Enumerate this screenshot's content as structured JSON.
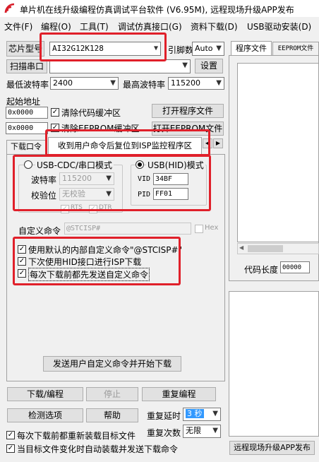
{
  "window": {
    "title": "单片机在线升级编程仿真调试平台软件 (V6.95M), 远程现场升级APP发布"
  },
  "menu": [
    "文件(F)",
    "编程(O)",
    "工具(T)",
    "调试仿真接口(G)",
    "资料下载(D)",
    "USB驱动安装(D)"
  ],
  "left": {
    "chip_label": "芯片型号",
    "chip_value": "AI32G12K128",
    "pin_label": "引脚数",
    "pin_value": "Auto",
    "scan_port": "扫描串口",
    "settings": "设置",
    "min_baud_label": "最低波特率",
    "min_baud_value": "2400",
    "max_baud_label": "最高波特率",
    "max_baud_value": "115200",
    "start_addr_label": "起始地址",
    "addr1": "0x0000",
    "clear_code": "清除代码缓冲区",
    "open_program": "打开程序文件",
    "addr2": "0x0000",
    "clear_eeprom": "清除EEPROM缓冲区",
    "open_eeprom": "打开EEPROM文件"
  },
  "subtabs": {
    "download_port": "下载口令",
    "isp_reset": "收到用户命令后复位到ISP监控程序区"
  },
  "isp": {
    "usb_cdc_label": "USB-CDC/串口模式",
    "baud_label": "波特率",
    "baud_value": "115200",
    "parity_label": "校验位",
    "parity_value": "无校验",
    "rts_label": "RTS",
    "dtr_label": "DTR",
    "usb_hid_label": "USB(HID)模式",
    "vid_label": "VID",
    "vid_value": "34BF",
    "pid_label": "PID",
    "pid_value": "FF01",
    "custom_cmd_label": "自定义命令",
    "custom_cmd_value": "@STCISP#",
    "hex_label": "Hex",
    "opt1": "使用默认的内部自定义命令\"@STCISP#\"",
    "opt2": "下次使用HID接口进行ISP下载",
    "opt3": "每次下载前都先发送自定义命令",
    "send_btn": "发送用户自定义命令并开始下载"
  },
  "bottom": {
    "download": "下载/编程",
    "stop": "停止",
    "reprogram": "重复编程",
    "check": "检测选项",
    "help": "帮助",
    "delay_label": "重复延时",
    "delay_value": "3 秒",
    "count_label": "重复次数",
    "count_value": "无限",
    "reload_before": "每次下载前都重新装载目标文件",
    "auto_reload": "当目标文件变化时自动装载并发送下载命令"
  },
  "right": {
    "tab_program": "程序文件",
    "tab_eeprom": "EEPROM文件",
    "code_len_label": "代码长度",
    "code_len_value": "00000",
    "remote_btn": "远程现场升级APP发布"
  },
  "colors": {
    "highlight": "#e0202a",
    "selection": "#3399ff"
  }
}
